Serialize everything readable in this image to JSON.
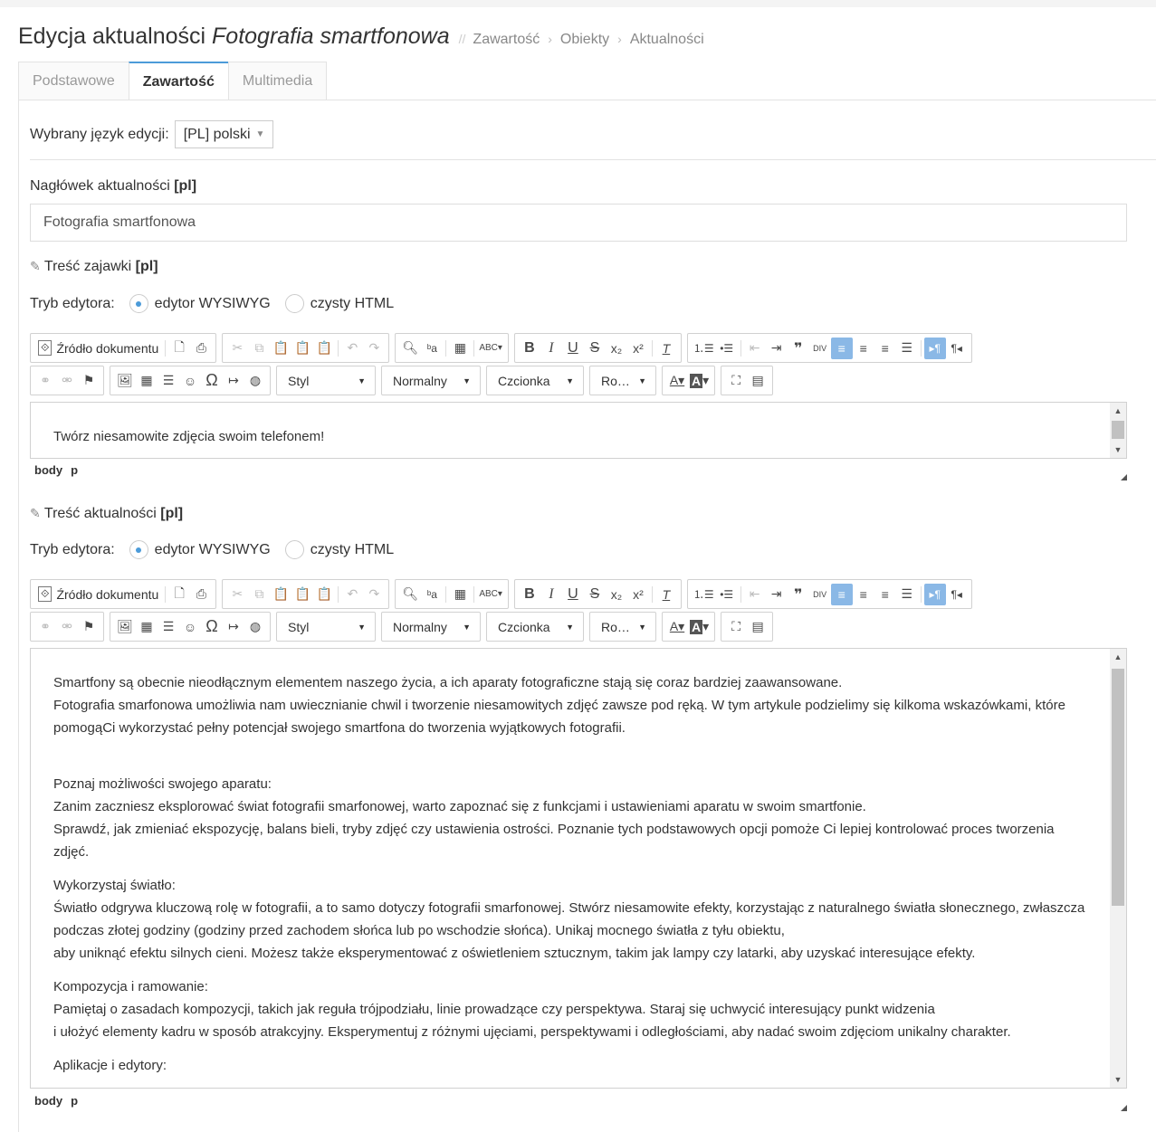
{
  "header": {
    "title_prefix": "Edycja aktualności",
    "title_italic": "Fotografia smartfonowa",
    "breadcrumb": [
      "Zawartość",
      "Obiekty",
      "Aktualności"
    ]
  },
  "tabs": [
    "Podstawowe",
    "Zawartość",
    "Multimedia"
  ],
  "language": {
    "label": "Wybrany język edycji:",
    "value": "[PL] polski"
  },
  "headline": {
    "label": "Nagłówek aktualności",
    "lang_tag": "[pl]",
    "value": "Fotografia smartfonowa"
  },
  "lead": {
    "label": "Treść zajawki",
    "lang_tag": "[pl]",
    "mode_label": "Tryb edytora:",
    "mode_wysiwyg": "edytor WYSIWYG",
    "mode_html": "czysty HTML",
    "content": "Twórz niesamowite zdjęcia swoim telefonem!",
    "path": [
      "body",
      "p"
    ]
  },
  "body": {
    "label": "Treść aktualności",
    "lang_tag": "[pl]",
    "mode_label": "Tryb edytora:",
    "mode_wysiwyg": "edytor WYSIWYG",
    "mode_html": "czysty HTML",
    "paragraphs": [
      [
        "Smartfony są obecnie nieodłącznym elementem naszego życia, a ich aparaty fotograficzne stają się coraz bardziej zaawansowane.",
        "Fotografia smarfonowa umożliwia nam uwiecznianie chwil i tworzenie niesamowitych zdjęć zawsze pod ręką. W tym artykule podzielimy się kilkoma wskazówkami, które pomogąCi wykorzystać pełny potencjał swojego smartfona do tworzenia wyjątkowych fotografii."
      ],
      [
        "Poznaj możliwości swojego aparatu:",
        "Zanim zaczniesz eksplorować świat fotografii smarfonowej, warto zapoznać się z funkcjami i ustawieniami aparatu w swoim smartfonie.",
        "Sprawdź, jak zmieniać ekspozycję, balans bieli, tryby zdjęć czy ustawienia ostrości. Poznanie tych podstawowych opcji pomoże Ci lepiej kontrolować proces tworzenia zdjęć."
      ],
      [
        "Wykorzystaj światło:",
        "Światło odgrywa kluczową rolę w fotografii, a to samo dotyczy fotografii smarfonowej. Stwórz niesamowite efekty, korzystając z naturalnego światła słonecznego, zwłaszcza podczas złotej godziny (godziny przed zachodem słońca lub po wschodzie słońca). Unikaj mocnego światła z tyłu obiektu,",
        "aby uniknąć efektu silnych cieni. Możesz także eksperymentować z oświetleniem sztucznym, takim jak lampy czy latarki, aby uzyskać interesujące efekty."
      ],
      [
        "Kompozycja i ramowanie:",
        "Pamiętaj o zasadach kompozycji, takich jak reguła trójpodziału, linie prowadzące czy perspektywa. Staraj się uchwycić interesujący punkt widzenia",
        "i ułożyć elementy kadru w sposób atrakcyjny. Eksperymentuj z różnymi ujęciami, perspektywami i odległościami, aby nadać swoim zdjęciom unikalny charakter."
      ],
      [
        "Aplikacje i edytory:"
      ]
    ],
    "path": [
      "body",
      "p"
    ]
  },
  "toolbar": {
    "source_label": "Źródło dokumentu",
    "style_label": "Styl",
    "format_label": "Normalny",
    "font_label": "Czcionka",
    "size_label": "Ro…"
  }
}
